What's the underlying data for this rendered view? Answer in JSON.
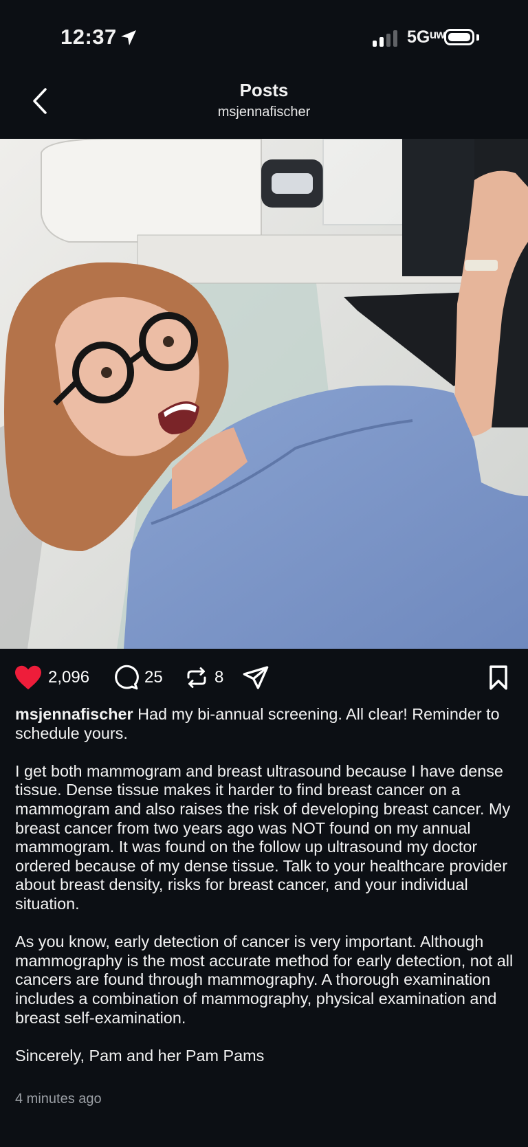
{
  "status": {
    "time": "12:37",
    "network": "5Gᵘʷ"
  },
  "header": {
    "title": "Posts",
    "subtitle": "msjennafischer"
  },
  "photo": {
    "alt": "Selfie of a woman in a blue hospital gown next to a mammography machine"
  },
  "actions": {
    "likes": "2,096",
    "comments": "25",
    "reposts": "8",
    "like_color": "#ee1d3a"
  },
  "post": {
    "username": "msjennafischer",
    "caption_intro": "Had my bi-annual screening. All clear! Reminder to schedule yours.",
    "paragraph_1": "I get both mammogram and breast ultrasound because I have dense tissue. Dense tissue makes it harder to find breast cancer on a mammogram and also raises the risk of developing breast cancer. My breast cancer from two years ago was NOT found on my annual mammogram. It was found on the follow up ultrasound my doctor ordered because of my dense tissue. Talk to your healthcare provider about breast density, risks for breast cancer, and your individual situation.",
    "paragraph_2": "As you know, early detection of cancer is very important. Although mammography is the most accurate method for early detection, not all cancers are found through mammography. A thorough examination includes a combination of mammography, physical examination and breast self-examination.",
    "sign_off": "Sincerely, Pam and her Pam Pams",
    "timestamp": "4 minutes ago"
  }
}
